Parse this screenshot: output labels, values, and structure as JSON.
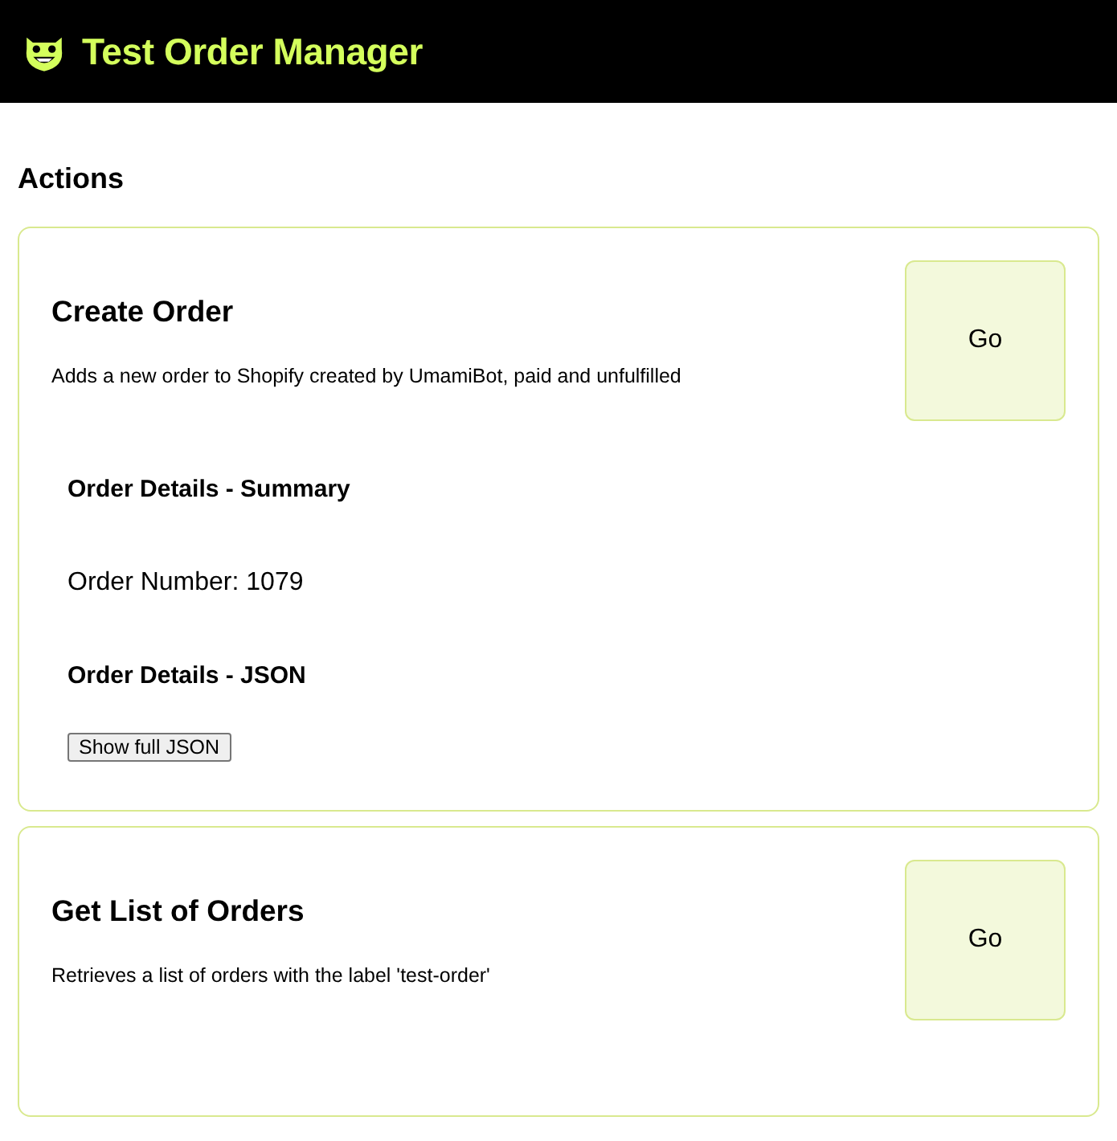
{
  "header": {
    "title": "Test Order Manager"
  },
  "section": {
    "title": "Actions"
  },
  "actions": [
    {
      "title": "Create Order",
      "description": "Adds a new order to Shopify created by UmamiBot, paid and unfulfilled",
      "button": "Go",
      "details": {
        "summary_heading": "Order Details - Summary",
        "order_number": "Order Number: 1079",
        "json_heading": "Order Details - JSON",
        "json_button": "Show full JSON"
      }
    },
    {
      "title": "Get List of Orders",
      "description": "Retrieves a list of orders with the label 'test-order'",
      "button": "Go"
    }
  ]
}
